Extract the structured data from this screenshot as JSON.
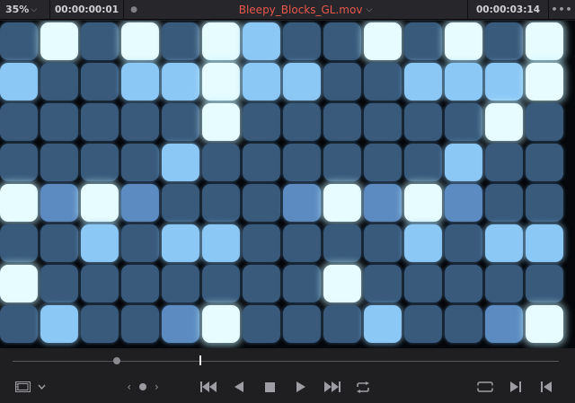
{
  "header": {
    "zoom_value": "35%",
    "zoom_chevron_icon": "chevron-down-icon",
    "timecode_current": "00:00:00:01",
    "clip_title": "Bleepy_Blocks_GL.mov",
    "clip_title_color": "#e8574c",
    "timecode_duration": "00:00:03:14",
    "more_icon": "ellipsis-icon"
  },
  "viewer": {
    "block_colors": [
      "#395a7b",
      "#5b8bc0",
      "#8cc8f6",
      "#e6fcff"
    ],
    "block_grid": [
      [
        0,
        3,
        0,
        3,
        0,
        3,
        2,
        0,
        0,
        3,
        0,
        3,
        0,
        3
      ],
      [
        2,
        0,
        0,
        2,
        2,
        3,
        2,
        2,
        0,
        0,
        2,
        2,
        2,
        3
      ],
      [
        0,
        0,
        0,
        0,
        0,
        3,
        0,
        0,
        0,
        0,
        0,
        0,
        3,
        0
      ],
      [
        0,
        0,
        0,
        0,
        2,
        0,
        0,
        0,
        0,
        0,
        0,
        2,
        0,
        0
      ],
      [
        3,
        1,
        3,
        1,
        0,
        0,
        0,
        1,
        3,
        1,
        3,
        1,
        0,
        0
      ],
      [
        0,
        0,
        2,
        0,
        2,
        2,
        0,
        0,
        0,
        0,
        2,
        0,
        2,
        2
      ],
      [
        3,
        0,
        0,
        0,
        0,
        0,
        0,
        0,
        3,
        0,
        0,
        0,
        0,
        0
      ],
      [
        0,
        2,
        0,
        0,
        1,
        3,
        0,
        0,
        0,
        2,
        0,
        0,
        1,
        3
      ]
    ]
  },
  "scrubber": {
    "playhead_position": 0.02
  },
  "transport": {
    "viewer_mode_icon": "film-frame-icon",
    "viewer_mode_chevron": "chevron-down-icon",
    "jog_left": "‹",
    "jog_right": "›",
    "icons": [
      "jump-to-start-icon",
      "play-reverse-icon",
      "stop-icon",
      "play-icon",
      "jump-to-end-icon",
      "loop-icon",
      "match-frame-icon",
      "next-clip-icon",
      "previous-clip-icon"
    ]
  }
}
